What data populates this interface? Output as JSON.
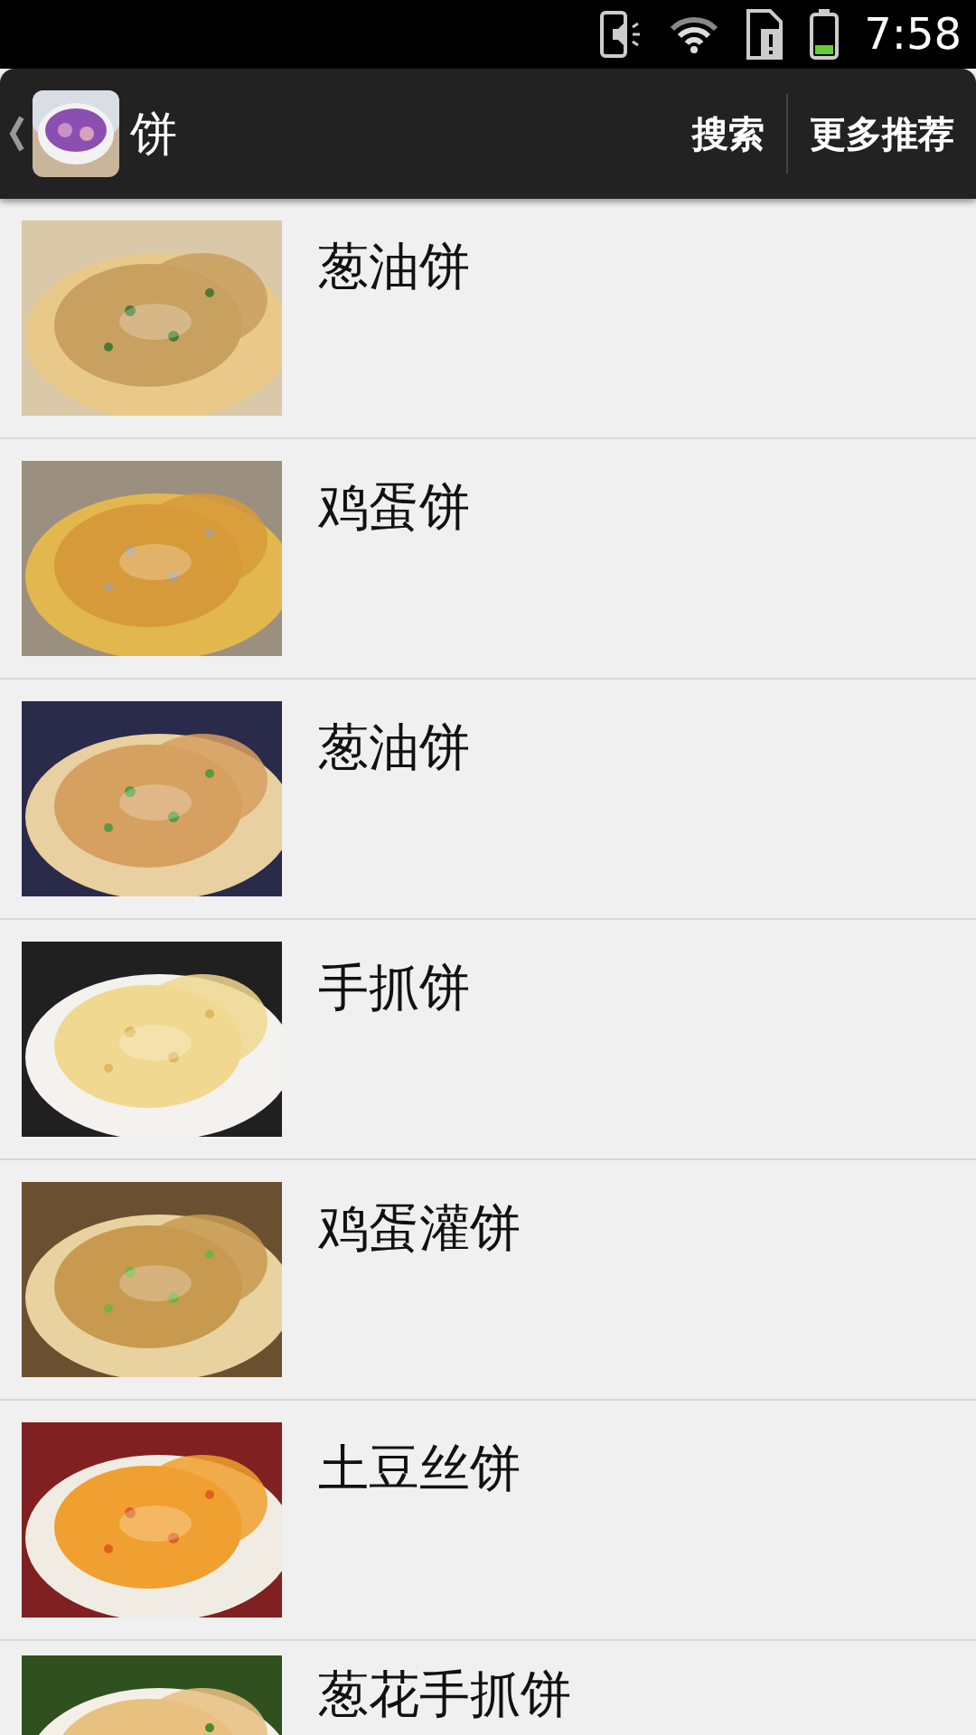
{
  "status_bar": {
    "time": "7:58"
  },
  "action_bar": {
    "title": "饼",
    "actions": [
      "搜索",
      "更多推荐"
    ]
  },
  "recipes": [
    {
      "title": "葱油饼"
    },
    {
      "title": "鸡蛋饼"
    },
    {
      "title": "葱油饼"
    },
    {
      "title": "手抓饼"
    },
    {
      "title": "鸡蛋灌饼"
    },
    {
      "title": "土豆丝饼"
    },
    {
      "title": "葱花手抓饼"
    }
  ]
}
